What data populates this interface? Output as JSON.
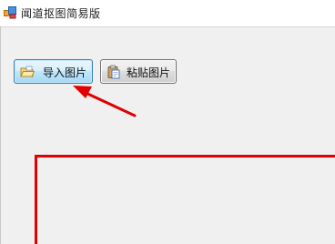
{
  "window": {
    "title": "闻道抠图简易版"
  },
  "toolbar": {
    "import_label": "导入图片",
    "paste_label": "粘贴图片"
  },
  "icons": {
    "app": "app-icon",
    "import": "open-folder-icon",
    "paste": "paste-icon"
  },
  "colors": {
    "annotation": "#e00000",
    "client_background": "#f0f0f0",
    "import_button_border": "#3c7fb1"
  }
}
